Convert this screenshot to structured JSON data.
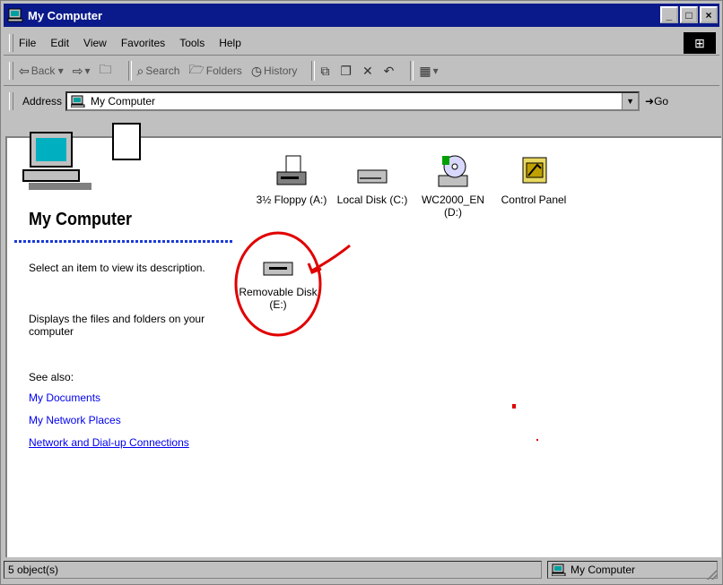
{
  "window": {
    "title": "My Computer",
    "minimize_glyph": "_",
    "maximize_glyph": "□",
    "close_glyph": "×"
  },
  "menu": [
    "File",
    "Edit",
    "View",
    "Favorites",
    "Tools",
    "Help"
  ],
  "toolbar": {
    "back_label": "Back",
    "forward_label": "",
    "up_label": "",
    "search_label": "Search",
    "folders_label": "Folders",
    "history_label": "History"
  },
  "address": {
    "label": "Address",
    "value": "My Computer",
    "go_label": "Go"
  },
  "left_panel": {
    "heading": "My Computer",
    "description": "Select an item to view its description.",
    "description2": "Displays the files and folders on your computer",
    "see_also_label": "See also:",
    "links": [
      "My Documents",
      "My Network Places",
      "Network and Dial-up Connections"
    ]
  },
  "items": [
    {
      "label": "3½ Floppy (A:)",
      "icon": "floppy-drive-icon"
    },
    {
      "label": "Local Disk (C:)",
      "icon": "hard-disk-icon"
    },
    {
      "label": "WC2000_EN (D:)",
      "icon": "cd-drive-icon"
    },
    {
      "label": "Control Panel",
      "icon": "control-panel-icon"
    },
    {
      "label": "Removable Disk (E:)",
      "icon": "removable-disk-icon"
    }
  ],
  "status": {
    "left": "5 object(s)",
    "right": "My Computer"
  },
  "colors": {
    "titlebar": "#0a1a8a",
    "face": "#c0c0c0",
    "link": "#0000ee",
    "annotation": "#e00000"
  }
}
